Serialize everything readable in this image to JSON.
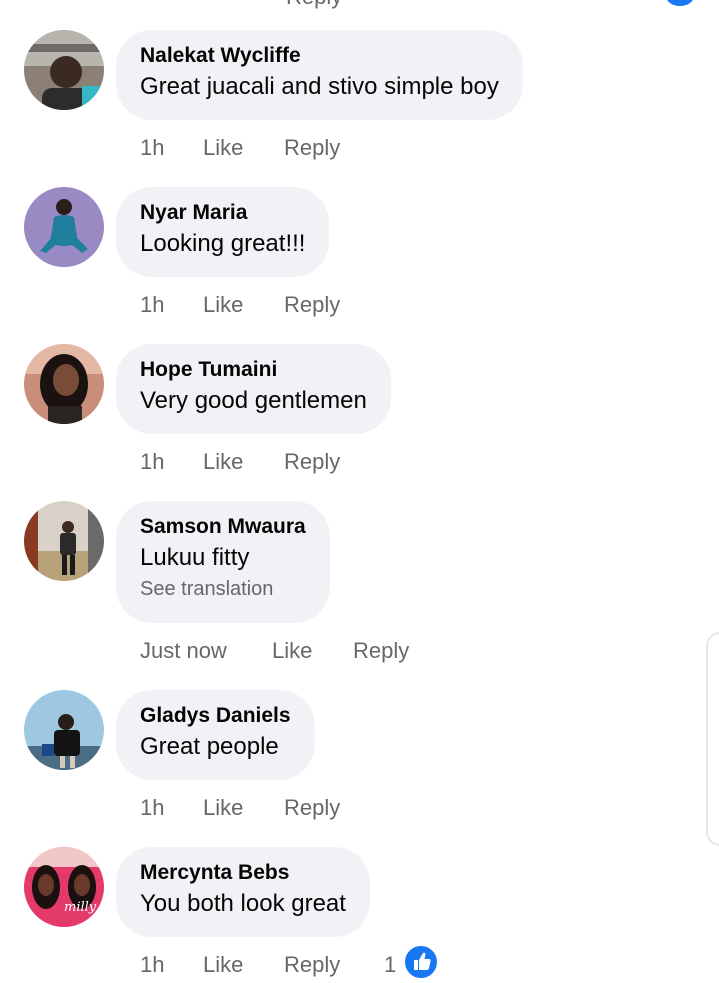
{
  "top_fragment": "Reply",
  "comments": [
    {
      "author": "Nalekat Wycliffe",
      "text": "Great juacali and stivo simple boy",
      "time": "1h",
      "like": "Like",
      "reply": "Reply"
    },
    {
      "author": "Nyar Maria",
      "text": "Looking great!!!",
      "time": "1h",
      "like": "Like",
      "reply": "Reply"
    },
    {
      "author": "Hope Tumaini",
      "text": "Very good gentlemen",
      "time": "1h",
      "like": "Like",
      "reply": "Reply"
    },
    {
      "author": "Samson Mwaura",
      "text": "Lukuu fitty",
      "translation": "See translation",
      "time": "Just now",
      "like": "Like",
      "reply": "Reply"
    },
    {
      "author": "Gladys Daniels",
      "text": "Great people",
      "time": "1h",
      "like": "Like",
      "reply": "Reply"
    },
    {
      "author": "Mercynta Bebs",
      "text": "You both look great",
      "time": "1h",
      "like": "Like",
      "reply": "Reply",
      "reaction_count": "1",
      "avatar_overlay_text": "milly"
    }
  ],
  "colors": {
    "bubble": "#f0f2f5",
    "meta_text": "#65676b",
    "accent": "#1877f2"
  },
  "icons": {
    "like_reaction": "thumbs-up-icon"
  }
}
